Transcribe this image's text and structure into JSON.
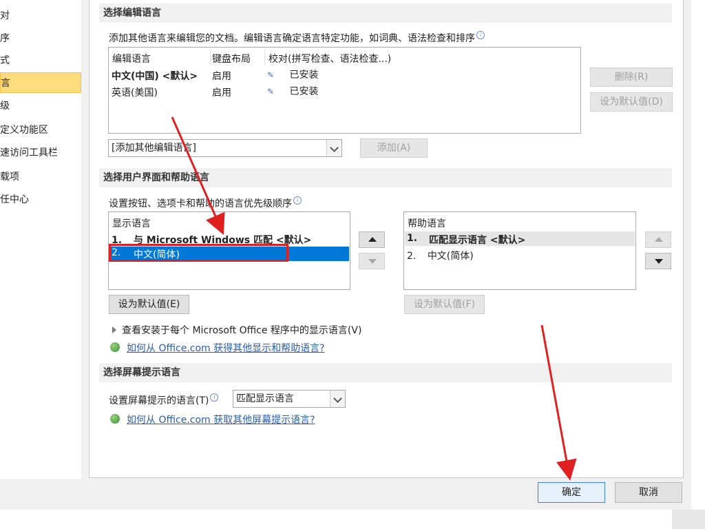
{
  "sidebar": {
    "items": [
      {
        "label": "对",
        "selected": false
      },
      {
        "label": "序",
        "selected": false
      },
      {
        "label": "式",
        "selected": false
      },
      {
        "label": "言",
        "selected": true
      },
      {
        "label": "级",
        "selected": false
      },
      {
        "label": "定义功能区",
        "selected": false
      },
      {
        "label": "速访问工具栏",
        "selected": false
      },
      {
        "label": "载项",
        "selected": false
      },
      {
        "label": "任中心",
        "selected": false
      }
    ]
  },
  "editing": {
    "header": "选择编辑语言",
    "description": "添加其他语言来编辑您的文档。编辑语言确定语言特定功能，如词典、语法检查和排序",
    "columns": [
      "编辑语言",
      "键盘布局",
      "校对(拼写检查、语法检查...)"
    ],
    "rows": [
      {
        "language": "中文(中国) <默认>",
        "keyboard": "启用",
        "proofing": "已安装",
        "bold": true
      },
      {
        "language": "英语(美国)",
        "keyboard": "启用",
        "proofing": "已安装",
        "bold": false
      }
    ],
    "remove_button": "删除(R)",
    "set_default_button": "设为默认值(D)",
    "add_combo_value": "[添加其他编辑语言]",
    "add_button": "添加(A)"
  },
  "ui_lang": {
    "header": "选择用户界面和帮助语言",
    "description": "设置按钮、选项卡和帮助的语言优先级顺序",
    "display": {
      "title": "显示语言",
      "items": [
        {
          "num": "1.",
          "label": "与 Microsoft Windows 匹配 <默认>",
          "bold": true,
          "selected": false
        },
        {
          "num": "2.",
          "label": "中文(简体)",
          "bold": false,
          "selected": true
        }
      ],
      "set_default_button": "设为默认值(E)"
    },
    "help": {
      "title": "帮助语言",
      "items": [
        {
          "num": "1.",
          "label": "匹配显示语言 <默认>",
          "bold": true
        },
        {
          "num": "2.",
          "label": "中文(简体)",
          "bold": false
        }
      ],
      "set_default_button": "设为默认值(F)"
    },
    "expander_text": "查看安装于每个 Microsoft Office 程序中的显示语言(V)",
    "link": "如何从 Office.com 获得其他显示和帮助语言?"
  },
  "screentip": {
    "header": "选择屏幕提示语言",
    "label": "设置屏幕提示的语言(T)",
    "combo_value": "匹配显示语言",
    "link": "如何从 Office.com 获取其他屏幕提示语言?"
  },
  "footer": {
    "ok": "确定",
    "cancel": "取消"
  },
  "colors": {
    "selection": "#0078d7",
    "accent_red": "#e02020",
    "sidebar_selected": "#fcdc7c"
  }
}
